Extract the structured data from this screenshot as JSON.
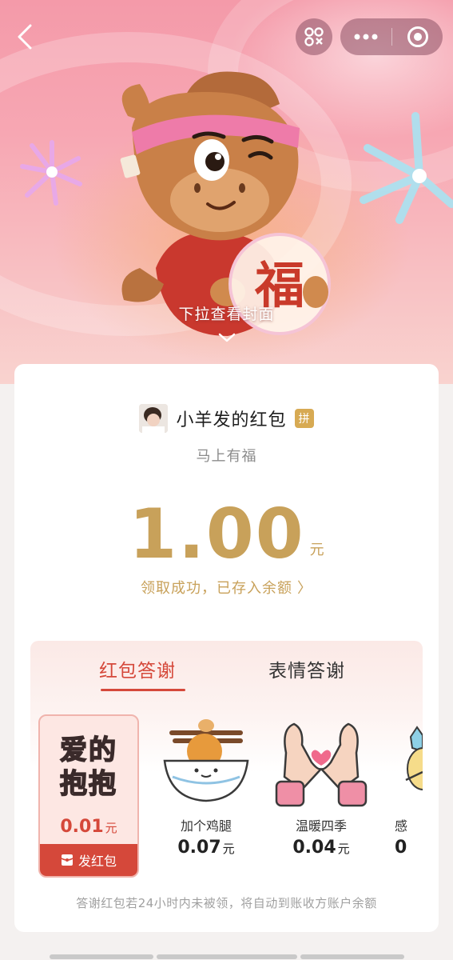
{
  "hero": {
    "pull_hint": "下拉查看封面",
    "character_text": "福"
  },
  "nav": {
    "back_icon": "chevron-left-icon",
    "left_capsule_icon": "scan-icon",
    "more_icon": "more-dots-icon",
    "close_icon": "target-close-icon"
  },
  "packet": {
    "sender_name": "小羊发的红包",
    "group_badge": "拼",
    "blessing": "马上有福",
    "amount": "1.00",
    "unit": "元",
    "status": "领取成功，已存入余额",
    "status_arrow": "〉"
  },
  "thanks": {
    "tabs": [
      {
        "label": "红包答谢",
        "active": true
      },
      {
        "label": "表情答谢",
        "active": false
      }
    ],
    "gifts": [
      {
        "art_line1": "爱的",
        "art_line2": "抱抱",
        "price": "0.01",
        "unit": "元",
        "selected": true
      },
      {
        "name": "加个鸡腿",
        "price": "0.07",
        "unit": "元"
      },
      {
        "name": "温暖四季",
        "price": "0.04",
        "unit": "元"
      },
      {
        "name": "感",
        "price": "0",
        "unit": ""
      }
    ],
    "send_label": "发红包",
    "footnote": "答谢红包若24小时内未被领，将自动到账收方账户余额"
  },
  "colors": {
    "gold": "#c8a15a",
    "red": "#d5483a",
    "badge": "#d7aa53"
  }
}
